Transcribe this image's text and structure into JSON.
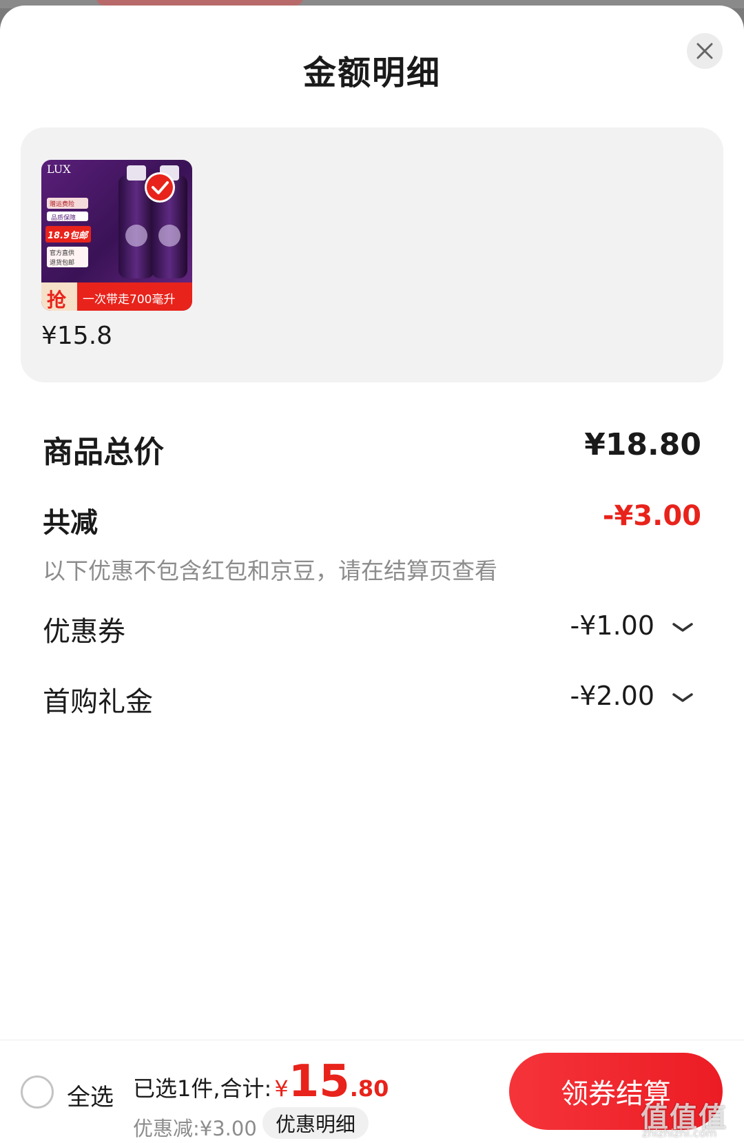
{
  "sheet": {
    "title": "金额明细"
  },
  "product": {
    "brand": "LUX",
    "badge_top": "赠运费险",
    "badge_mid": "品质保障",
    "badge_price": "18.9包邮",
    "badge_line1": "官方直供",
    "badge_line2": "退货包邮",
    "banner_tag": "抢",
    "banner_text": "一次带走700毫升",
    "price": "¥15.8",
    "selected": true
  },
  "summary_rows": {
    "total_label": "商品总价",
    "total_value": "¥18.80",
    "reduce_label": "共减",
    "reduce_value": "-¥3.00",
    "note": "以下优惠不包含红包和京豆，请在结算页查看"
  },
  "discounts": [
    {
      "label": "优惠券",
      "value": "-¥1.00"
    },
    {
      "label": "首购礼金",
      "value": "-¥2.00"
    }
  ],
  "footer": {
    "select_all": "全选",
    "selected_text": "已选1件,合计:",
    "currency": "¥",
    "total_int": "15",
    "total_dec": ".80",
    "discount_text": "优惠减:¥3.00",
    "detail_button": "优惠明细",
    "checkout_button": "领券结算"
  },
  "watermark": {
    "glyphs": "值值值",
    "url": "zhizhizhi.com"
  },
  "colors": {
    "accent_red": "#e8231b",
    "muted_text": "#8c8c8c",
    "card_bg": "#f2f2f2"
  },
  "icons": {
    "close": "close-icon",
    "chevron": "chevron-down-icon",
    "check": "check-circle-icon",
    "radio": "radio-unchecked-icon"
  }
}
